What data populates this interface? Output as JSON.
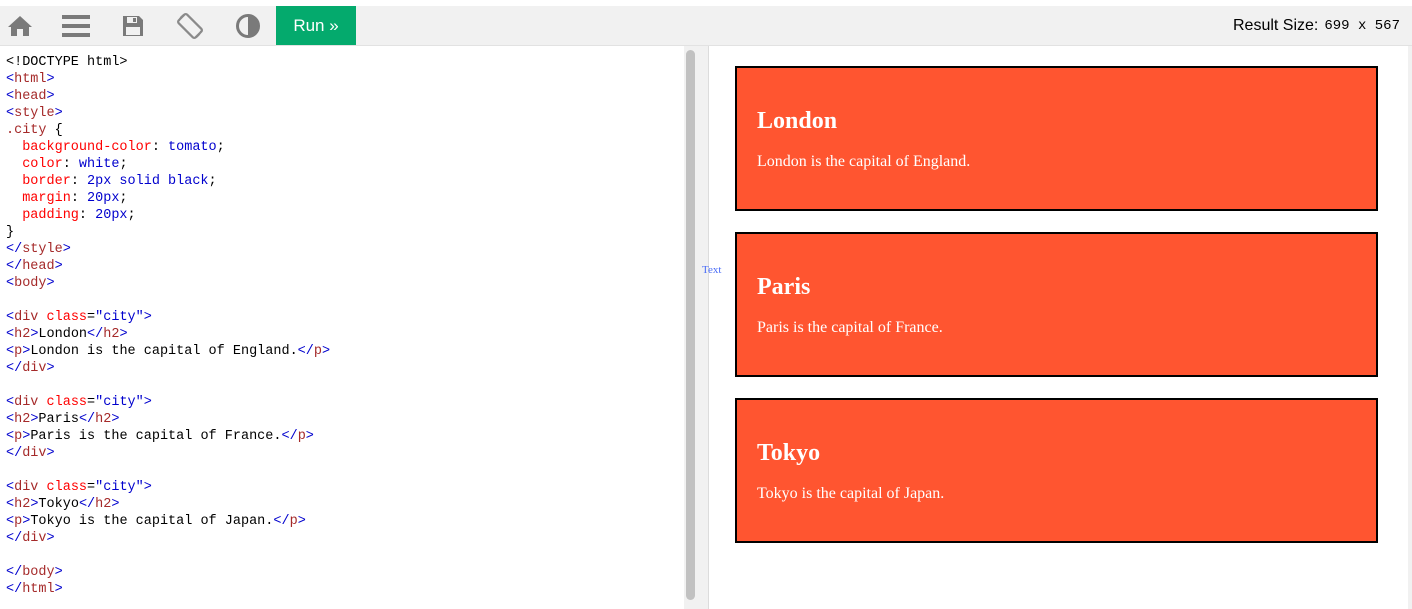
{
  "toolbar": {
    "icons": [
      "home-icon",
      "menu-icon",
      "save-icon",
      "rotate-icon",
      "contrast-icon"
    ],
    "run_label": "Run »",
    "result_size_label": "Result Size:",
    "result_size_value": "699 x 567",
    "run_color": "#04aa6d"
  },
  "editor": {
    "lines": [
      "<!DOCTYPE html>",
      "<html>",
      "<head>",
      "<style>",
      ".city {",
      "  background-color: tomato;",
      "  color: white;",
      "  border: 2px solid black;",
      "  margin: 20px;",
      "  padding: 20px;",
      "}",
      "</style>",
      "</head>",
      "<body>",
      "",
      "<div class=\"city\">",
      "<h2>London</h2>",
      "<p>London is the capital of England.</p>",
      "</div>",
      "",
      "<div class=\"city\">",
      "<h2>Paris</h2>",
      "<p>Paris is the capital of France.</p>",
      "</div>",
      "",
      "<div class=\"city\">",
      "<h2>Tokyo</h2>",
      "<p>Tokyo is the capital of Japan.</p>",
      "</div>",
      "",
      "</body>",
      "</html>"
    ]
  },
  "result": {
    "text_label": "Text",
    "city_bg": "#ff5530",
    "cities": [
      {
        "heading": "London",
        "text": "London is the capital of England."
      },
      {
        "heading": "Paris",
        "text": "Paris is the capital of France."
      },
      {
        "heading": "Tokyo",
        "text": "Tokyo is the capital of Japan."
      }
    ]
  }
}
